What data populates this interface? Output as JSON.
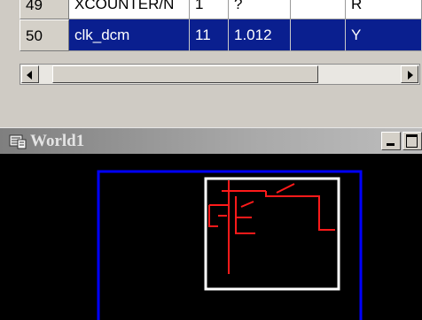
{
  "table": {
    "rows": [
      {
        "index": "49",
        "name": "XCOUNTER/N",
        "col3": "1",
        "col4": "?",
        "col5": "",
        "col6": "R"
      },
      {
        "index": "50",
        "name": "clk_dcm",
        "col3": "11",
        "col4": "1.012",
        "col5": "",
        "col6": "Y"
      }
    ],
    "selection_color": "#0a1f8f"
  },
  "world_window": {
    "title": "World1",
    "icon": "world-icon",
    "colors": {
      "canvas_background": "#000000",
      "boundary": "#0000ff",
      "viewport_frame": "#ffffff",
      "schematic": "#ff1a1a"
    }
  }
}
